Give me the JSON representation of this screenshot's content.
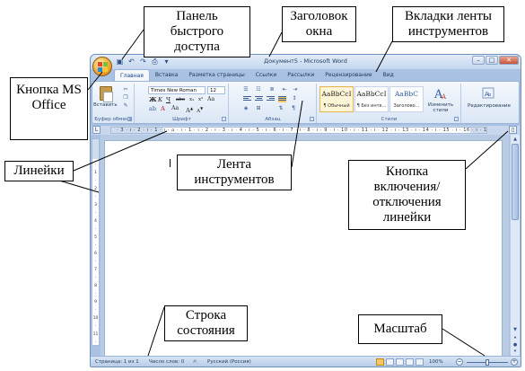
{
  "callouts": {
    "quick_access": "Панель быстрого доступа",
    "window_title": "Заголовок окна",
    "ribbon_tabs": "Вкладки ленты инструментов",
    "office_button": "Кнопка MS Office",
    "rulers": "Линейки",
    "ribbon": "Лента инструментов",
    "ruler_toggle": "Кнопка включения/ отключения линейки",
    "status_bar": "Строка состояния",
    "zoom": "Масштаб"
  },
  "window": {
    "title": "Документ5 - Microsoft Word"
  },
  "tabs": [
    "Главная",
    "Вставка",
    "Разметка страницы",
    "Ссылки",
    "Рассылки",
    "Рецензирование",
    "Вид"
  ],
  "ribbon": {
    "clipboard": {
      "label": "Буфер обмена",
      "paste": "Вставить"
    },
    "font": {
      "label": "Шрифт",
      "font_name": "Times New Roman",
      "font_size": "12"
    },
    "paragraph": {
      "label": "Абзац"
    },
    "styles": {
      "label": "Стили",
      "items": [
        {
          "sample": "AaBbCcI",
          "name": "¶ Обычный"
        },
        {
          "sample": "AaBbCcI",
          "name": "¶ Без инте..."
        },
        {
          "sample": "AaBbC",
          "name": "Заголово..."
        }
      ],
      "change_styles": "Изменить стили"
    },
    "editing": {
      "label": "Редактирование"
    }
  },
  "ruler_text": "· 3 · ı · 2 · ı · 1 · ı · ⌂ · ı · 1 · ı · 2 · ı · 3 · ı · 4 · ı · 5 · ı · 6 · ı · 7 · ı · 8 · ı · 9 · ı · 10 · ı · 11 · ı · 12 · ı · 13 · ı · 14 · ı · 15 · ı · 16 · ı · 17 ·",
  "status": {
    "page": "Страница: 1 из 1",
    "words": "Число слов: 0",
    "language": "Русский (Россия)",
    "zoom": "100%",
    "zoom_level": 0.5
  },
  "colors": {
    "window_frame": "#a9c2e4",
    "ribbon_bg": "#dbe7f6",
    "callout_border": "#000000"
  }
}
